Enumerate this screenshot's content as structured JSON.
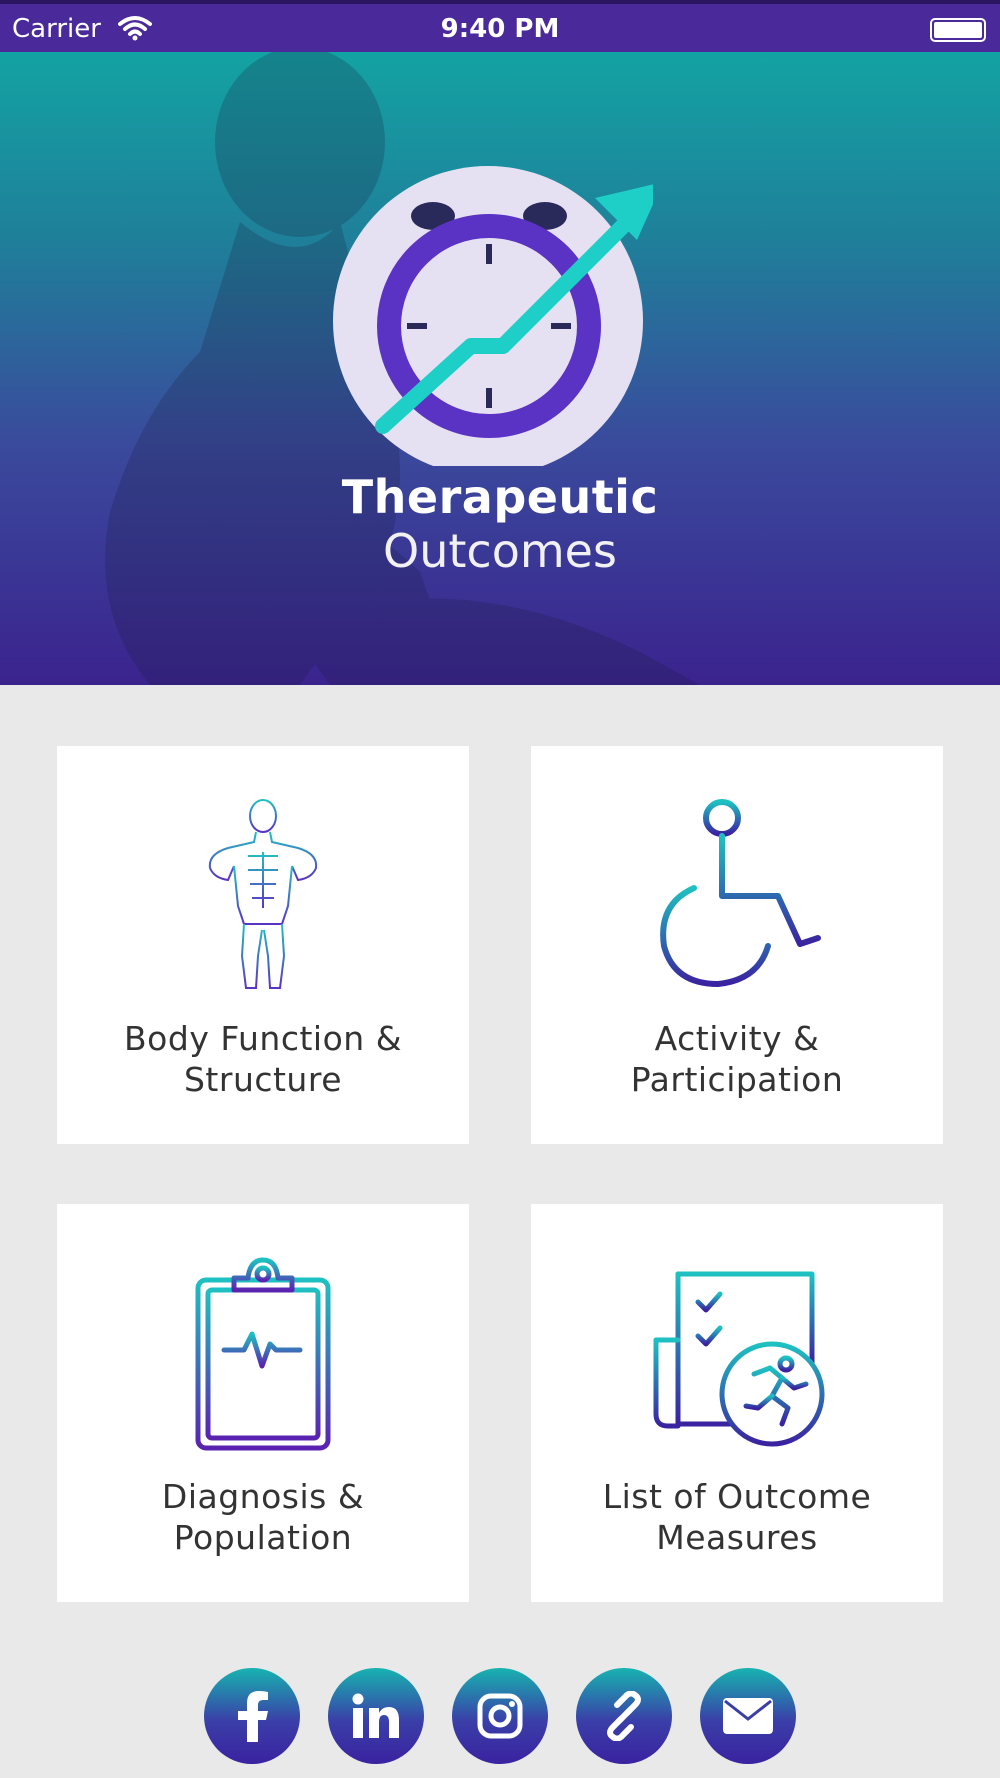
{
  "status_bar": {
    "carrier": "Carrier",
    "time": "9:40 PM"
  },
  "hero": {
    "title": "Therapeutic",
    "subtitle": "Outcomes",
    "logo_icon": "clock-trend-arrow-icon"
  },
  "cards": [
    {
      "line1": "Body Function &",
      "line2": "Structure",
      "icon": "body-anatomy-icon"
    },
    {
      "line1": "Activity &",
      "line2": "Participation",
      "icon": "wheelchair-icon"
    },
    {
      "line1": "Diagnosis &",
      "line2": "Population",
      "icon": "clipboard-heartbeat-icon"
    },
    {
      "line1": "List of Outcome",
      "line2": "Measures",
      "icon": "checklist-runner-icon"
    }
  ],
  "social": [
    {
      "icon": "facebook-icon"
    },
    {
      "icon": "linkedin-icon"
    },
    {
      "icon": "instagram-icon"
    },
    {
      "icon": "link-icon"
    },
    {
      "icon": "email-icon"
    }
  ],
  "colors": {
    "status_bar": "#4a2a9a",
    "hero_top": "#13a3a3",
    "hero_bottom": "#3b238e",
    "accent_teal": "#1ecfc8",
    "accent_purple": "#5a33c4",
    "page_background": "#e9e9e9"
  }
}
